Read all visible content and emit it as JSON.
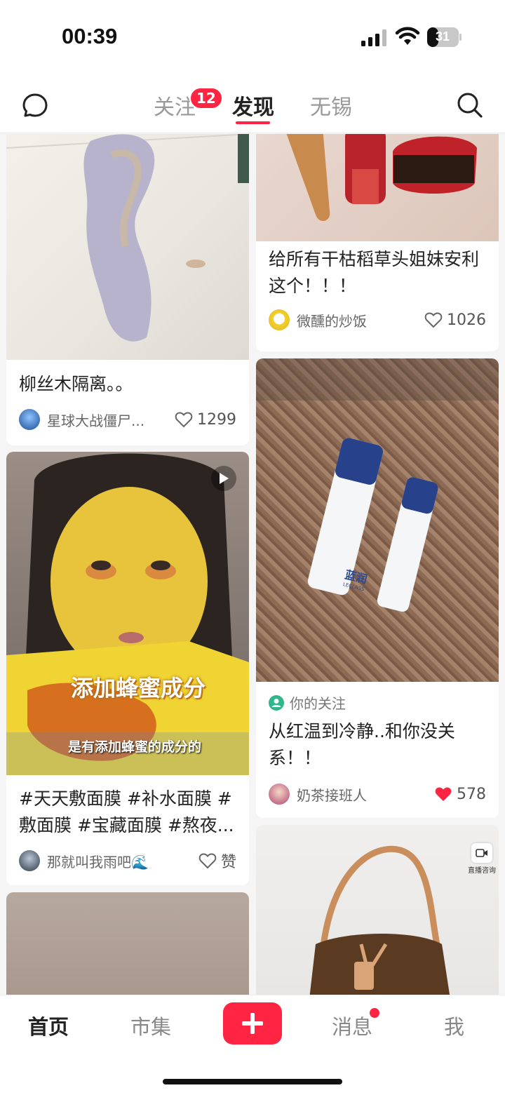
{
  "status": {
    "time": "00:39",
    "battery": "31"
  },
  "top_nav": {
    "tabs": [
      {
        "label": "关注",
        "badge": "12"
      },
      {
        "label": "发现"
      },
      {
        "label": "无锡"
      }
    ]
  },
  "feed": {
    "left": [
      {
        "title": "柳丝木隔离。。",
        "author": "星球大战僵尸...",
        "likes": "1299",
        "liked": false
      },
      {
        "title": "#天天敷面膜 #补水面膜 #敷面膜 #宝藏面膜 #熬夜...",
        "author": "那就叫我雨吧🌊",
        "likes": "赞",
        "liked": false,
        "is_video": true,
        "overlay_big": "添加蜂蜜成分",
        "overlay_small": "是有添加蜂蜜的成分的"
      },
      {
        "title": ""
      }
    ],
    "right": [
      {
        "title": "给所有干枯稻草头姐妹安利这个！！！",
        "author": "微醺的炒饭",
        "likes": "1026",
        "liked": false
      },
      {
        "tag": "你的关注",
        "title": "从红温到冷静..和你没关系！！",
        "author": "奶茶接班人",
        "likes": "578",
        "liked": true,
        "product_brand": "蓝润",
        "product_sub": "LECLASS"
      },
      {
        "live_label": "直播咨询"
      }
    ]
  },
  "bottom_nav": {
    "items": [
      "首页",
      "市集",
      "消息",
      "我"
    ]
  },
  "colors": {
    "accent": "#ff2442"
  }
}
